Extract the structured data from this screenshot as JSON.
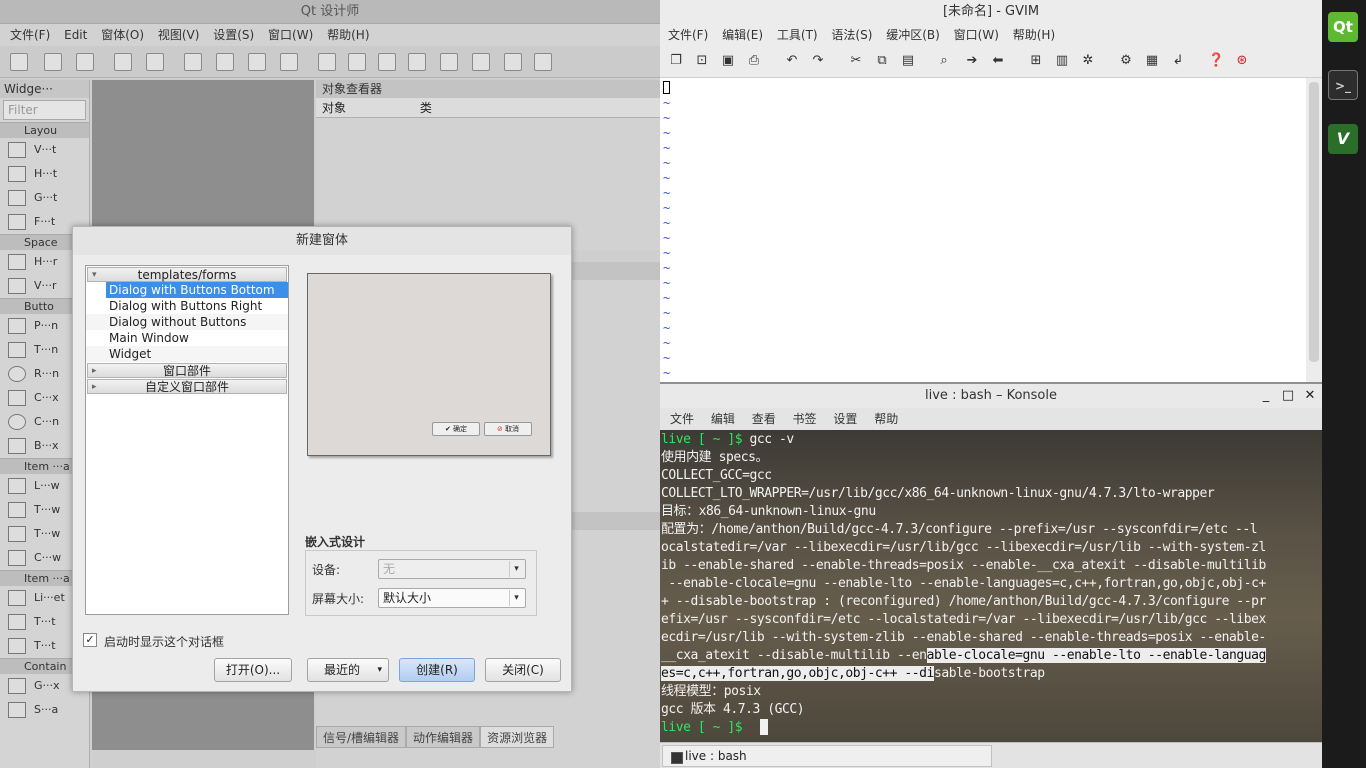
{
  "qt": {
    "title": "Qt 设计师",
    "menu": [
      "文件(F)",
      "Edit",
      "窗体(O)",
      "视图(V)",
      "设置(S)",
      "窗口(W)",
      "帮助(H)"
    ],
    "widgetbox": {
      "title": "Widge···",
      "filter_placeholder": "Filter",
      "cat_layouts": "Layou",
      "layouts": [
        "V···t",
        "H···t",
        "G···t",
        "F···t"
      ],
      "cat_spacers": "Space",
      "spacers": [
        "H···r",
        "V···r"
      ],
      "cat_buttons": "Butto",
      "buttons": [
        "P···n",
        "T···n",
        "R···n",
        "C···x",
        "C···n",
        "B···x"
      ],
      "cat_item_views": "Item ···a",
      "item_views": [
        "L···w",
        "T···w",
        "T···w",
        "C···w"
      ],
      "cat_item_widgets": "Item ···a",
      "item_widgets": [
        "Li···et",
        "T···t",
        "T···t"
      ],
      "cat_containers": "Contain",
      "containers": [
        "G···x",
        "S···a"
      ]
    },
    "object_inspector": {
      "title": "对象查看器",
      "col_object": "对象",
      "col_class": "类"
    },
    "bottom_tabs": [
      "信号/槽编辑器",
      "动作编辑器",
      "资源浏览器"
    ]
  },
  "dialog": {
    "title": "新建窗体",
    "tree": {
      "group_templates": "templates/forms",
      "templates": [
        "Dialog with Buttons Bottom",
        "Dialog with Buttons Right",
        "Dialog without Buttons",
        "Main Window",
        "Widget"
      ],
      "selected_index": 0,
      "group_widgets": "窗口部件",
      "group_custom": "自定义窗口部件"
    },
    "preview": {
      "ok": "确定",
      "cancel": "取消"
    },
    "embedded": {
      "title": "嵌入式设计",
      "device_label": "设备:",
      "device_value": "无",
      "screen_label": "屏幕大小:",
      "screen_value": "默认大小"
    },
    "show_on_startup": "启动时显示这个对话框",
    "show_on_startup_checked": true,
    "buttons": {
      "open": "打开(O)...",
      "recent": "最近的",
      "create": "创建(R)",
      "close": "关闭(C)"
    }
  },
  "gvim": {
    "title": "[未命名] - GVIM",
    "menu": [
      "文件(F)",
      "编辑(E)",
      "工具(T)",
      "语法(S)",
      "缓冲区(B)",
      "窗口(W)",
      "帮助(H)"
    ],
    "tilde": "~",
    "tilde_count": 19
  },
  "konsole": {
    "title": "live : bash – Konsole",
    "menu": [
      "文件",
      "编辑",
      "查看",
      "书签",
      "设置",
      "帮助"
    ],
    "prompt": "live [ ~ ]$",
    "command": " gcc -v",
    "lines": [
      "使用内建 specs。",
      "COLLECT_GCC=gcc",
      "COLLECT_LTO_WRAPPER=/usr/lib/gcc/x86_64-unknown-linux-gnu/4.7.3/lto-wrapper",
      "目标：x86_64-unknown-linux-gnu",
      "配置为：/home/anthon/Build/gcc-4.7.3/configure --prefix=/usr --sysconfdir=/etc --l",
      "ocalstatedir=/var --libexecdir=/usr/lib/gcc --libexecdir=/usr/lib --with-system-zl",
      "ib --enable-shared --enable-threads=posix --enable-__cxa_atexit --disable-multilib",
      " --enable-clocale=gnu --enable-lto --enable-languages=c,c++,fortran,go,objc,obj-c+",
      "+ --disable-bootstrap : (reconfigured) /home/anthon/Build/gcc-4.7.3/configure --pr",
      "efix=/usr --sysconfdir=/etc --localstatedir=/var --libexecdir=/usr/lib/gcc --libex",
      "ecdir=/usr/lib --with-system-zlib --enable-shared --enable-threads=posix --enable-"
    ],
    "line_sel_a_pre": "__cxa_atexit --disable-multilib --en",
    "line_sel_a_hl": "able-clocale=gnu --enable-lto --enable-languag",
    "line_sel_b_hl": "es=c,c++,fortran,go,objc,obj-c++ --di",
    "line_sel_b_post": "sable-bootstrap",
    "thread_model": "线程模型：posix",
    "version": "gcc 版本 4.7.3 (GCC)",
    "tab_label": "live : bash"
  },
  "launcher": {
    "qt": "Qt",
    "vim": "V"
  }
}
